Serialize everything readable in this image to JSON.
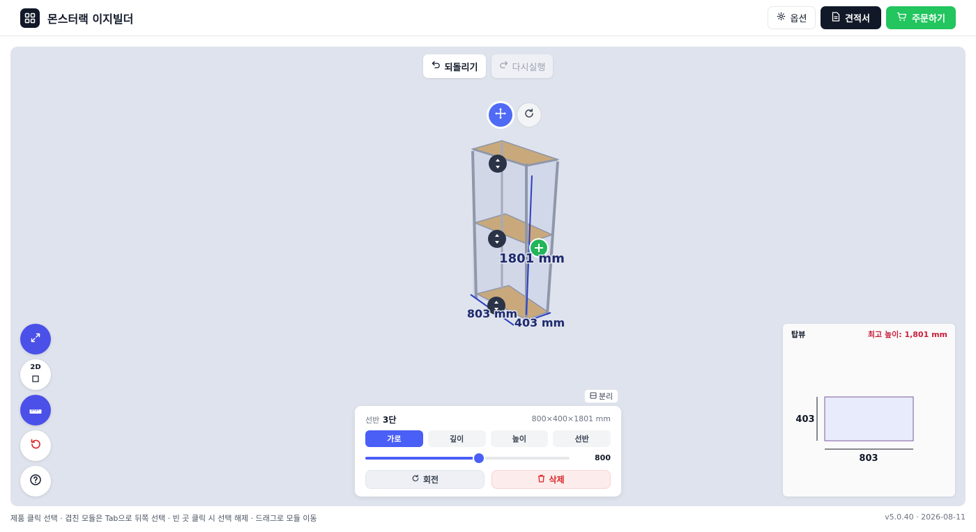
{
  "header": {
    "app_title": "몬스터랙 이지빌더",
    "options_label": "옵션",
    "quote_label": "견적서",
    "order_label": "주문하기"
  },
  "toolbar": {
    "undo_label": "되돌리기",
    "redo_label": "다시실행"
  },
  "scene": {
    "height_label": "1801 mm",
    "width_label": "803 mm",
    "depth_label": "403 mm"
  },
  "left_tools": [
    {
      "name": "expand",
      "icon": "expand-icon"
    },
    {
      "name": "view-2d",
      "label": "2D",
      "icon": "square-icon"
    },
    {
      "name": "ruler",
      "icon": "ruler-icon"
    },
    {
      "name": "reset",
      "icon": "reset-icon"
    },
    {
      "name": "help",
      "icon": "help-icon"
    }
  ],
  "panel": {
    "split_label": "분리",
    "shelf_label": "선반",
    "shelf_value": "3단",
    "dimensions": "800×400×1801 mm",
    "tabs": [
      "가로",
      "깊이",
      "높이",
      "선반"
    ],
    "active_tab": "가로",
    "slider_value": "800",
    "slider_fraction": 0.555,
    "rotate_label": "회전",
    "delete_label": "삭제"
  },
  "top_view": {
    "title": "탑뷰",
    "max_height": "최고 높이: 1,801 mm",
    "depth": "403",
    "width": "803"
  },
  "footer": {
    "hint": "제품 클릭 선택 · 겹친 모듈은 Tab으로 뒤쪽 선택 · 빈 곳 클릭 시 선택 해제 · 드래그로 모듈 이동",
    "version": "v5.0.40 · 2026-08-11"
  },
  "colors": {
    "accent": "#4a5ff5",
    "order_green": "#22c55e",
    "dark": "#111827",
    "danger": "#dc2626",
    "canvas": "#dfe3ed"
  }
}
